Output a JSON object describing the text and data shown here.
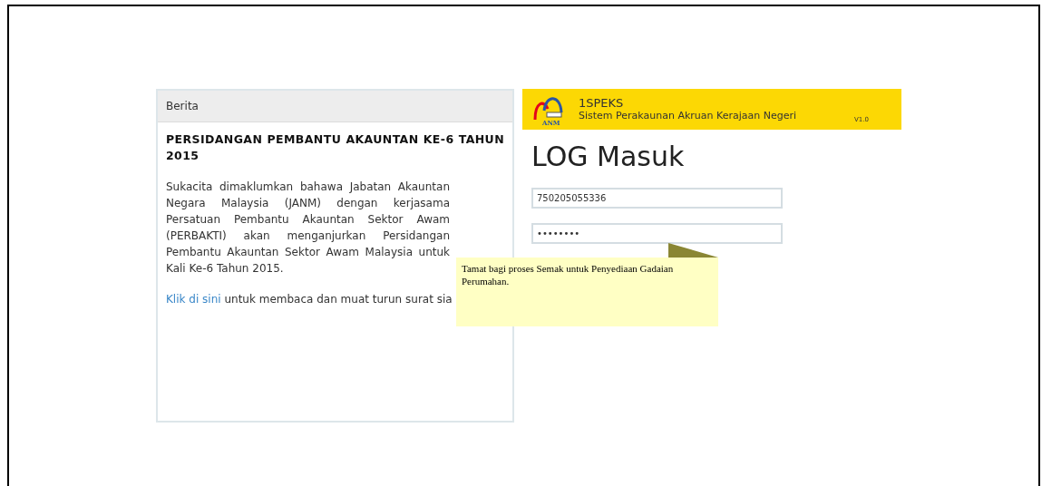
{
  "news_panel": {
    "header": "Berita",
    "title": "PERSIDANGAN PEMBANTU AKAUNTAN KE-6 TAHUN 2015",
    "body": "Sukacita dimaklumkan bahawa Jabatan Akauntan Negara Malaysia (JANM) dengan kerjasama Persatuan Pembantu Akauntan Sektor Awam (PERBAKTI) akan menganjurkan Persidangan Pembantu Akauntan Sektor Awam Malaysia untuk Kali Ke-6 Tahun 2015.",
    "link": "Klik di sini",
    "link_tail": "untuk membaca dan muat turun surat sia"
  },
  "login_panel": {
    "logo_text": "ANM",
    "app_name": "1SPEKS",
    "app_subtitle": "Sistem Perakaunan Akruan Kerajaan Negeri",
    "version": "V1.0",
    "heading": "LOG Masuk",
    "username": {
      "value": "750205055336"
    },
    "password": {
      "value": "••••••••"
    }
  },
  "tooltip": {
    "text": "Tamat bagi proses Semak untuk Penyediaan Gadaian Perumahan."
  }
}
